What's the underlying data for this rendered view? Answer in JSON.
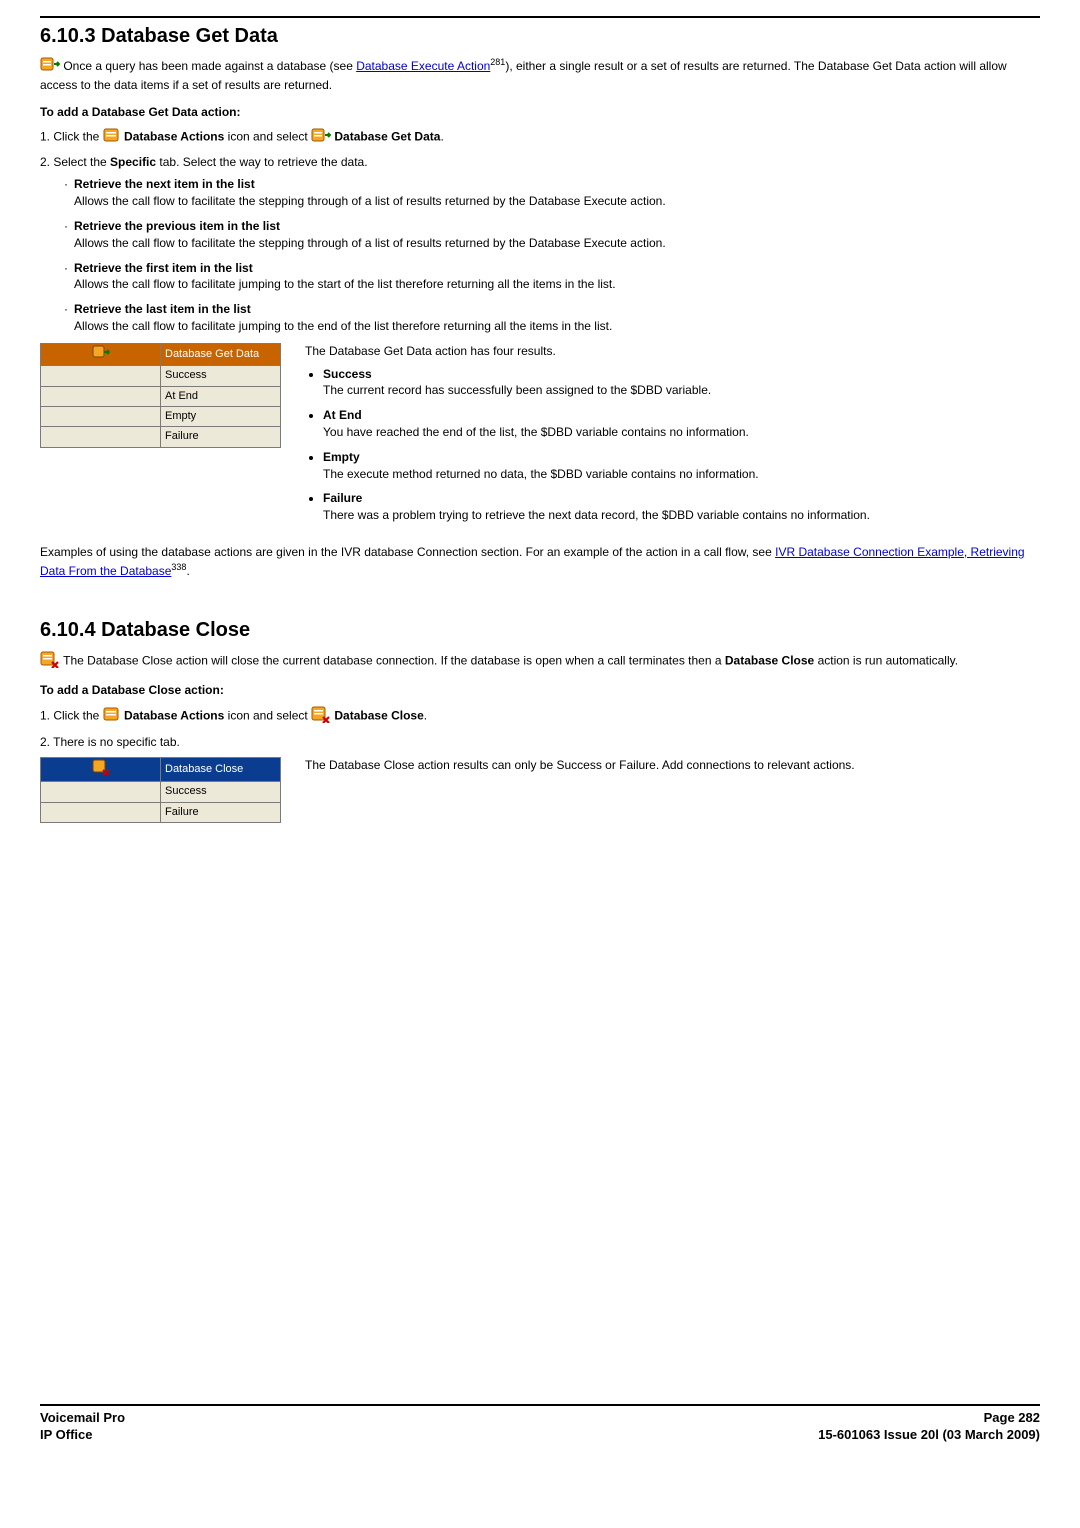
{
  "section1": {
    "title": "6.10.3 Database Get Data",
    "intro_a": " Once a query has been made against a database (see ",
    "intro_link": "Database Execute Action",
    "intro_sup": "281",
    "intro_b": "), either a single result or a set of results are returned. The Database Get Data action will allow access to the data items if a set of results are returned.",
    "add_heading": "To add a Database Get Data action:",
    "step1_a": "1. Click the ",
    "step1_b": " Database Actions",
    "step1_c": " icon and select ",
    "step1_d": " Database Get Data",
    "step1_e": ".",
    "step2": "2. Select the ",
    "step2_bold": "Specific",
    "step2_tail": " tab. Select the way to retrieve the data.",
    "bullets": [
      {
        "title": "Retrieve the next item in the list",
        "body": "Allows the call flow to facilitate the stepping through of a list of results returned by the Database Execute action."
      },
      {
        "title": "Retrieve the previous item in the list",
        "body": "Allows the call flow to facilitate the stepping through of a list of results returned by the Database Execute action."
      },
      {
        "title": "Retrieve the first item in the list",
        "body": "Allows the call flow to facilitate jumping to the start of the list therefore returning all the items in the list."
      },
      {
        "title": "Retrieve the last item in the list",
        "body": "Allows the call flow to facilitate jumping to the end of the list therefore returning all the items in the list."
      }
    ],
    "table_header": "Database Get Data",
    "table_rows": [
      "Success",
      "At End",
      "Empty",
      "Failure"
    ],
    "results_intro": "The Database Get Data action has four results.",
    "results": [
      {
        "title": "Success",
        "body": "The current record has successfully been assigned to the $DBD variable."
      },
      {
        "title": "At End",
        "body": "You have reached the end of the list, the $DBD variable contains no information."
      },
      {
        "title": "Empty",
        "body": "The execute method returned no data, the $DBD variable contains no information."
      },
      {
        "title": "Failure",
        "body": "There was a problem trying to retrieve the next data record, the $DBD variable contains no information."
      }
    ],
    "example_a": "Examples of using the database actions are given in the IVR database Connection section. For an example of the action in a call flow, see ",
    "example_link": "IVR Database Connection Example, Retrieving Data From the Database",
    "example_sup": "338",
    "example_b": "."
  },
  "section2": {
    "title": "6.10.4 Database Close",
    "intro": " The Database Close action will close the current database connection. If the database is open when a call terminates then a ",
    "intro_bold": "Database Close",
    "intro_tail": " action is run automatically.",
    "add_heading": "To add a Database Close action:",
    "step1_a": "1. Click the ",
    "step1_b": " Database Actions",
    "step1_c": " icon and select ",
    "step1_d": " Database Close",
    "step1_e": ".",
    "step2": "2. There is no specific tab.",
    "table_header": "Database Close",
    "table_rows": [
      "Success",
      "Failure"
    ],
    "results_text": "The Database Close action results can only be Success or Failure. Add connections to relevant actions."
  },
  "footer": {
    "left1": "Voicemail Pro",
    "left2": "IP Office",
    "right1": "Page 282",
    "right2": "15-601063 Issue 20l (03 March 2009)"
  }
}
